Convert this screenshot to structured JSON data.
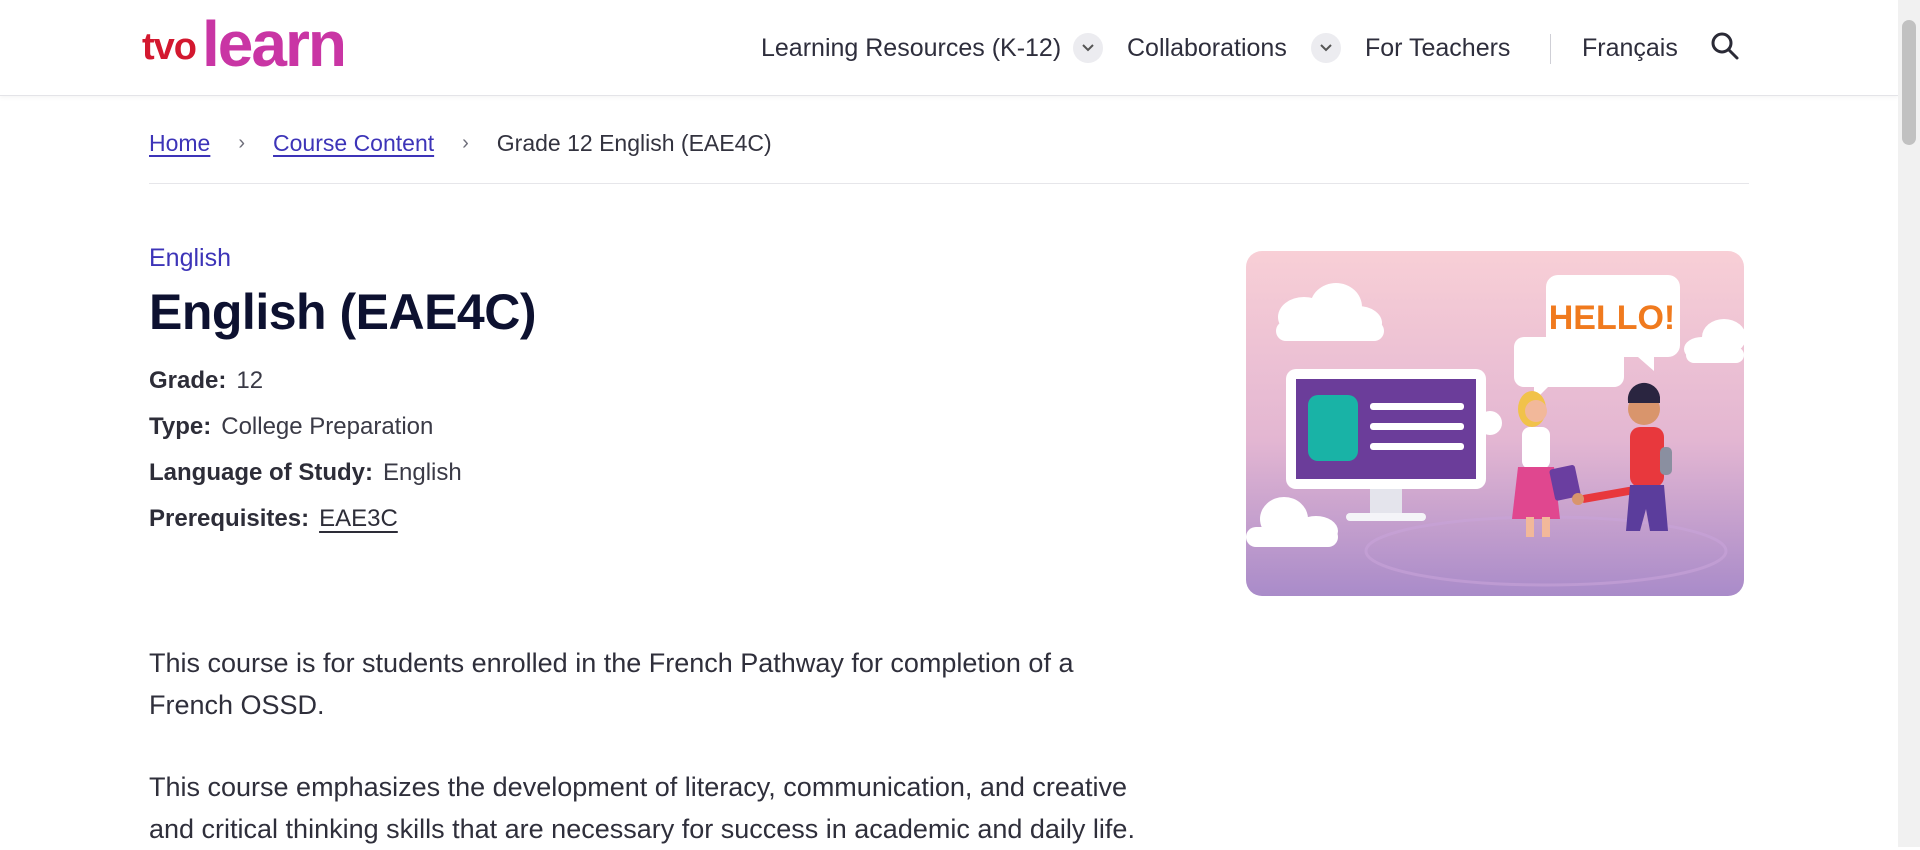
{
  "header": {
    "logo": {
      "tvo": "tvo",
      "learn": "learn"
    },
    "nav": [
      {
        "label": "Learning Resources (K-12)",
        "has_dropdown": true
      },
      {
        "label": "Collaborations",
        "has_dropdown": true
      },
      {
        "label": "For Teachers",
        "has_dropdown": false
      }
    ],
    "language_toggle": "Français",
    "search_icon": "search-icon"
  },
  "breadcrumb": {
    "home": "Home",
    "course_content": "Course Content",
    "current": "Grade 12 English (EAE4C)"
  },
  "course": {
    "subject": "English",
    "title": "English (EAE4C)",
    "grade_label": "Grade:",
    "grade": "12",
    "type_label": "Type:",
    "type": "College Preparation",
    "language_label": "Language of Study:",
    "language": "English",
    "prereq_label": "Prerequisites:",
    "prereq": "EAE3C"
  },
  "description": {
    "p1_line1": "This course is for students enrolled in the French Pathway for completion of a",
    "p1_line2": "French OSSD.",
    "p2_line1": "This course emphasizes the development of literacy, communication, and creative",
    "p2_line2": "and critical thinking skills that are necessary for success in academic and daily life."
  },
  "illustration": {
    "speech_bubble": "HELLO!"
  },
  "colors": {
    "accent": "#3d34b8",
    "brand_red": "#d3182f",
    "brand_magenta": "#c935a4",
    "title": "#0d1130"
  }
}
